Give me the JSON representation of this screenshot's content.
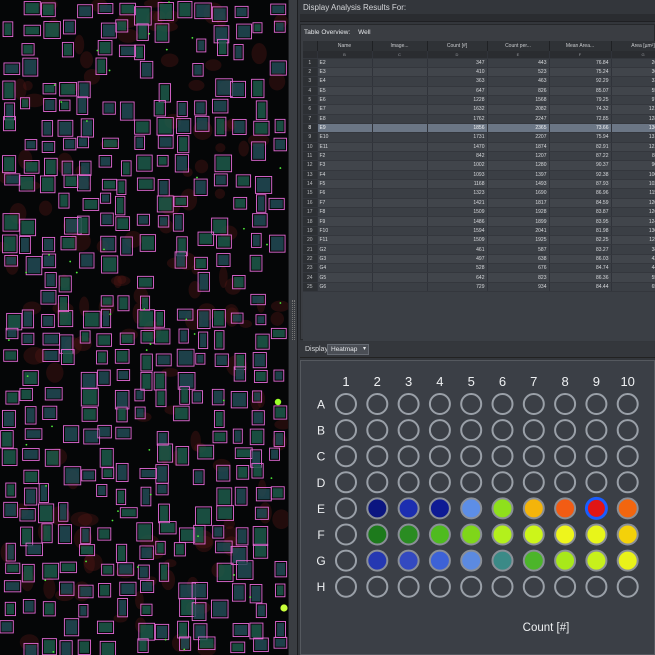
{
  "header": {
    "title": "Display Analysis Results For:"
  },
  "overview": {
    "label": "Table Overview:",
    "value": "Well"
  },
  "table": {
    "columns": [
      "Name",
      "Image...",
      "Count [#]",
      "Count per...",
      "Mean Area...",
      "Area [µm²]"
    ],
    "letters": [
      "A",
      "B",
      "C",
      "D",
      "E",
      "F",
      "G"
    ],
    "rows": [
      {
        "n": "1",
        "name": "E2",
        "count": "347",
        "cper": "443",
        "marea": "76.84",
        "area": "26664.92"
      },
      {
        "n": "2",
        "name": "E3",
        "count": "410",
        "cper": "523",
        "marea": "75.24",
        "area": "30850.40"
      },
      {
        "n": "3",
        "name": "E4",
        "count": "363",
        "cper": "463",
        "marea": "92.29",
        "area": "33500.92"
      },
      {
        "n": "4",
        "name": "E5",
        "count": "647",
        "cper": "826",
        "marea": "85.07",
        "area": "55041.44"
      },
      {
        "n": "5",
        "name": "E6",
        "count": "1228",
        "cper": "1568",
        "marea": "79.25",
        "area": "97314.64"
      },
      {
        "n": "6",
        "name": "E7",
        "count": "1632",
        "cper": "2082",
        "marea": "74.32",
        "area": "121288.00"
      },
      {
        "n": "7",
        "name": "E8",
        "count": "1762",
        "cper": "2247",
        "marea": "72.85",
        "area": "128361.16"
      },
      {
        "n": "8",
        "name": "E9",
        "count": "1856",
        "cper": "2365",
        "marea": "73.66",
        "area": "136710.24"
      },
      {
        "n": "9",
        "name": "E10",
        "count": "1731",
        "cper": "2207",
        "marea": "75.94",
        "area": "131446.16"
      },
      {
        "n": "10",
        "name": "E11",
        "count": "1470",
        "cper": "1874",
        "marea": "82.91",
        "area": "121873.96"
      },
      {
        "n": "11",
        "name": "F2",
        "count": "842",
        "cper": "1207",
        "marea": "87.22",
        "area": "82117.68"
      },
      {
        "n": "12",
        "name": "F3",
        "count": "1002",
        "cper": "1280",
        "marea": "90.37",
        "area": "90545.92"
      },
      {
        "n": "13",
        "name": "F4",
        "count": "1093",
        "cper": "1397",
        "marea": "92.38",
        "area": "100970.68"
      },
      {
        "n": "14",
        "name": "F5",
        "count": "1168",
        "cper": "1493",
        "marea": "87.93",
        "area": "102705.84"
      },
      {
        "n": "15",
        "name": "F6",
        "count": "1323",
        "cper": "1690",
        "marea": "86.96",
        "area": "115043.00"
      },
      {
        "n": "16",
        "name": "F7",
        "count": "1421",
        "cper": "1817",
        "marea": "84.59",
        "area": "120209.00"
      },
      {
        "n": "17",
        "name": "F8",
        "count": "1509",
        "cper": "1928",
        "marea": "83.87",
        "area": "126554.20"
      },
      {
        "n": "18",
        "name": "F9",
        "count": "1486",
        "cper": "1899",
        "marea": "83.95",
        "area": "124743.48"
      },
      {
        "n": "19",
        "name": "F10",
        "count": "1594",
        "cper": "2041",
        "marea": "81.98",
        "area": "130661.60"
      },
      {
        "n": "20",
        "name": "F11",
        "count": "1509",
        "cper": "1925",
        "marea": "82.25",
        "area": "124115.88"
      },
      {
        "n": "21",
        "name": "G2",
        "count": "461",
        "cper": "587",
        "marea": "83.27",
        "area": "38385.60"
      },
      {
        "n": "22",
        "name": "G3",
        "count": "497",
        "cper": "638",
        "marea": "86.03",
        "area": "42759.24"
      },
      {
        "n": "23",
        "name": "G4",
        "count": "528",
        "cper": "676",
        "marea": "84.74",
        "area": "44740.56"
      },
      {
        "n": "24",
        "name": "G5",
        "count": "642",
        "cper": "823",
        "marea": "86.36",
        "area": "55440.84"
      },
      {
        "n": "25",
        "name": "G6",
        "count": "729",
        "cper": "934",
        "marea": "84.44",
        "area": "65577.28"
      }
    ],
    "selected_row": 7
  },
  "display": {
    "label": "Display",
    "mode": "Heatmap"
  },
  "plate": {
    "columns": [
      "1",
      "2",
      "3",
      "4",
      "5",
      "6",
      "7",
      "8",
      "9",
      "10"
    ],
    "rows": [
      "A",
      "B",
      "C",
      "D",
      "E",
      "F",
      "G",
      "H"
    ],
    "colored": {
      "E": [
        "",
        "#0b1580",
        "#1c2eb0",
        "#0e1a94",
        "#5d8ee6",
        "#8fe01c",
        "#f4b40a",
        "#f25c14",
        "#e11515",
        "#f2660f"
      ],
      "F": [
        "",
        "#1d7a1c",
        "#2a8c22",
        "#4fbb1f",
        "#7fd61a",
        "#b3f01c",
        "#ccf51a",
        "#eef51c",
        "#e8f51a",
        "#f4d10a"
      ],
      "G": [
        "",
        "#2538b2",
        "#3349c0",
        "#3d62d6",
        "#5c8ae0",
        "#3b8a87",
        "#4cb52a",
        "#a8e81a",
        "#c7f01c",
        "#e9f21a"
      ]
    },
    "highlight_well": "E9",
    "highlight_color": "#1a5dff",
    "axis_label": "Count [#]"
  }
}
